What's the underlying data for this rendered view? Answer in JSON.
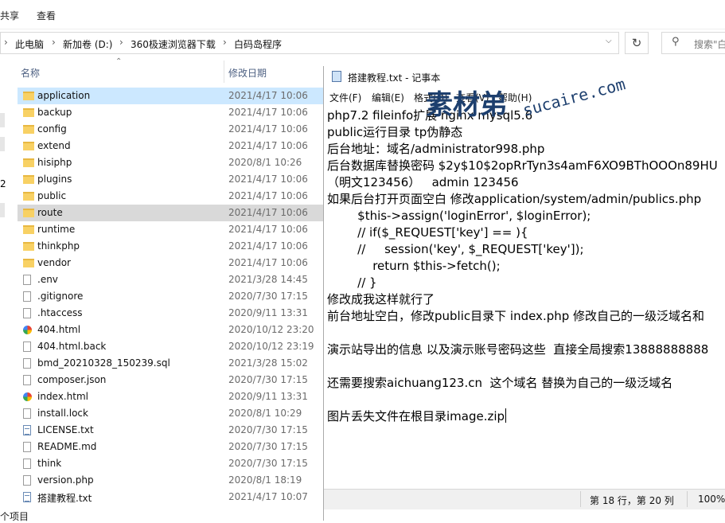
{
  "ribbon": {
    "share": "共享",
    "view": "查看"
  },
  "address": {
    "crumbs": [
      "此电脑",
      "新加卷 (D:)",
      "360极速浏览器下载",
      "白码岛程序"
    ],
    "separator": "›",
    "search_placeholder": "搜索\"白"
  },
  "columns": {
    "name": "名称",
    "date": "修改日期"
  },
  "files": [
    {
      "name": "application",
      "date": "2021/4/17 10:06",
      "type": "folder"
    },
    {
      "name": "backup",
      "date": "2021/4/17 10:06",
      "type": "folder"
    },
    {
      "name": "config",
      "date": "2021/4/17 10:06",
      "type": "folder"
    },
    {
      "name": "extend",
      "date": "2021/4/17 10:06",
      "type": "folder"
    },
    {
      "name": "hisiphp",
      "date": "2020/8/1 10:26",
      "type": "folder"
    },
    {
      "name": "plugins",
      "date": "2021/4/17 10:06",
      "type": "folder"
    },
    {
      "name": "public",
      "date": "2021/4/17 10:06",
      "type": "folder"
    },
    {
      "name": "route",
      "date": "2021/4/17 10:06",
      "type": "folder"
    },
    {
      "name": "runtime",
      "date": "2021/4/17 10:06",
      "type": "folder"
    },
    {
      "name": "thinkphp",
      "date": "2021/4/17 10:06",
      "type": "folder"
    },
    {
      "name": "vendor",
      "date": "2021/4/17 10:06",
      "type": "folder"
    },
    {
      "name": ".env",
      "date": "2021/3/28 14:45",
      "type": "file"
    },
    {
      "name": ".gitignore",
      "date": "2020/7/30 17:15",
      "type": "file"
    },
    {
      "name": ".htaccess",
      "date": "2020/9/11 13:31",
      "type": "file"
    },
    {
      "name": "404.html",
      "date": "2020/10/12 23:20",
      "type": "html"
    },
    {
      "name": "404.html.back",
      "date": "2020/10/12 23:19",
      "type": "file"
    },
    {
      "name": "bmd_20210328_150239.sql",
      "date": "2021/3/28 15:02",
      "type": "file"
    },
    {
      "name": "composer.json",
      "date": "2020/7/30 17:15",
      "type": "file"
    },
    {
      "name": "index.html",
      "date": "2020/9/11 13:31",
      "type": "html"
    },
    {
      "name": "install.lock",
      "date": "2020/8/1 10:29",
      "type": "file"
    },
    {
      "name": "LICENSE.txt",
      "date": "2020/7/30 17:15",
      "type": "txt"
    },
    {
      "name": "README.md",
      "date": "2020/7/30 17:15",
      "type": "file"
    },
    {
      "name": "think",
      "date": "2020/7/30 17:15",
      "type": "file"
    },
    {
      "name": "version.php",
      "date": "2020/8/1 18:19",
      "type": "file"
    },
    {
      "name": "搭建教程.txt",
      "date": "2021/4/17 10:07",
      "type": "txt"
    }
  ],
  "left_nav_digit": "2",
  "items_trailer": "个项目",
  "notepad": {
    "title": "搭建教程.txt - 记事本",
    "menu": [
      "文件(F)",
      "编辑(E)",
      "格式(O)",
      "查看(V)",
      "帮助(H)"
    ],
    "lines": [
      "php7.2 fileinfo扩展 nginx mysql5.6",
      "public运行目录 tp伪静态",
      "后台地址：域名/administrator998.php",
      "后台数据库替换密码 $2y$10$2opRrTyn3s4amF6XO9BThOOOn89HU",
      "（明文123456）   admin 123456",
      "如果后台打开页面空白 修改application/system/admin/publics.php",
      "        $this->assign('loginError', $loginError);",
      "        // if($_REQUEST['key'] == ){",
      "        //     session('key', $_REQUEST['key']);",
      "            return $this->fetch();",
      "        // }",
      "修改成我这样就行了",
      "前台地址空白，修改public目录下 index.php 修改自己的一级泛域名和",
      "",
      "演示站导出的信息 以及演示账号密码这些  直接全局搜索13888888888",
      "",
      "还需要搜索aichuang123.cn  这个域名 替换为自己的一级泛域名",
      "",
      "图片丢失文件在根目录image.zip"
    ],
    "status_position": "第 18 行，第 20 列",
    "status_zoom": "100%"
  },
  "watermark": {
    "cn": "素材弟",
    "url": "sucaire.com"
  }
}
